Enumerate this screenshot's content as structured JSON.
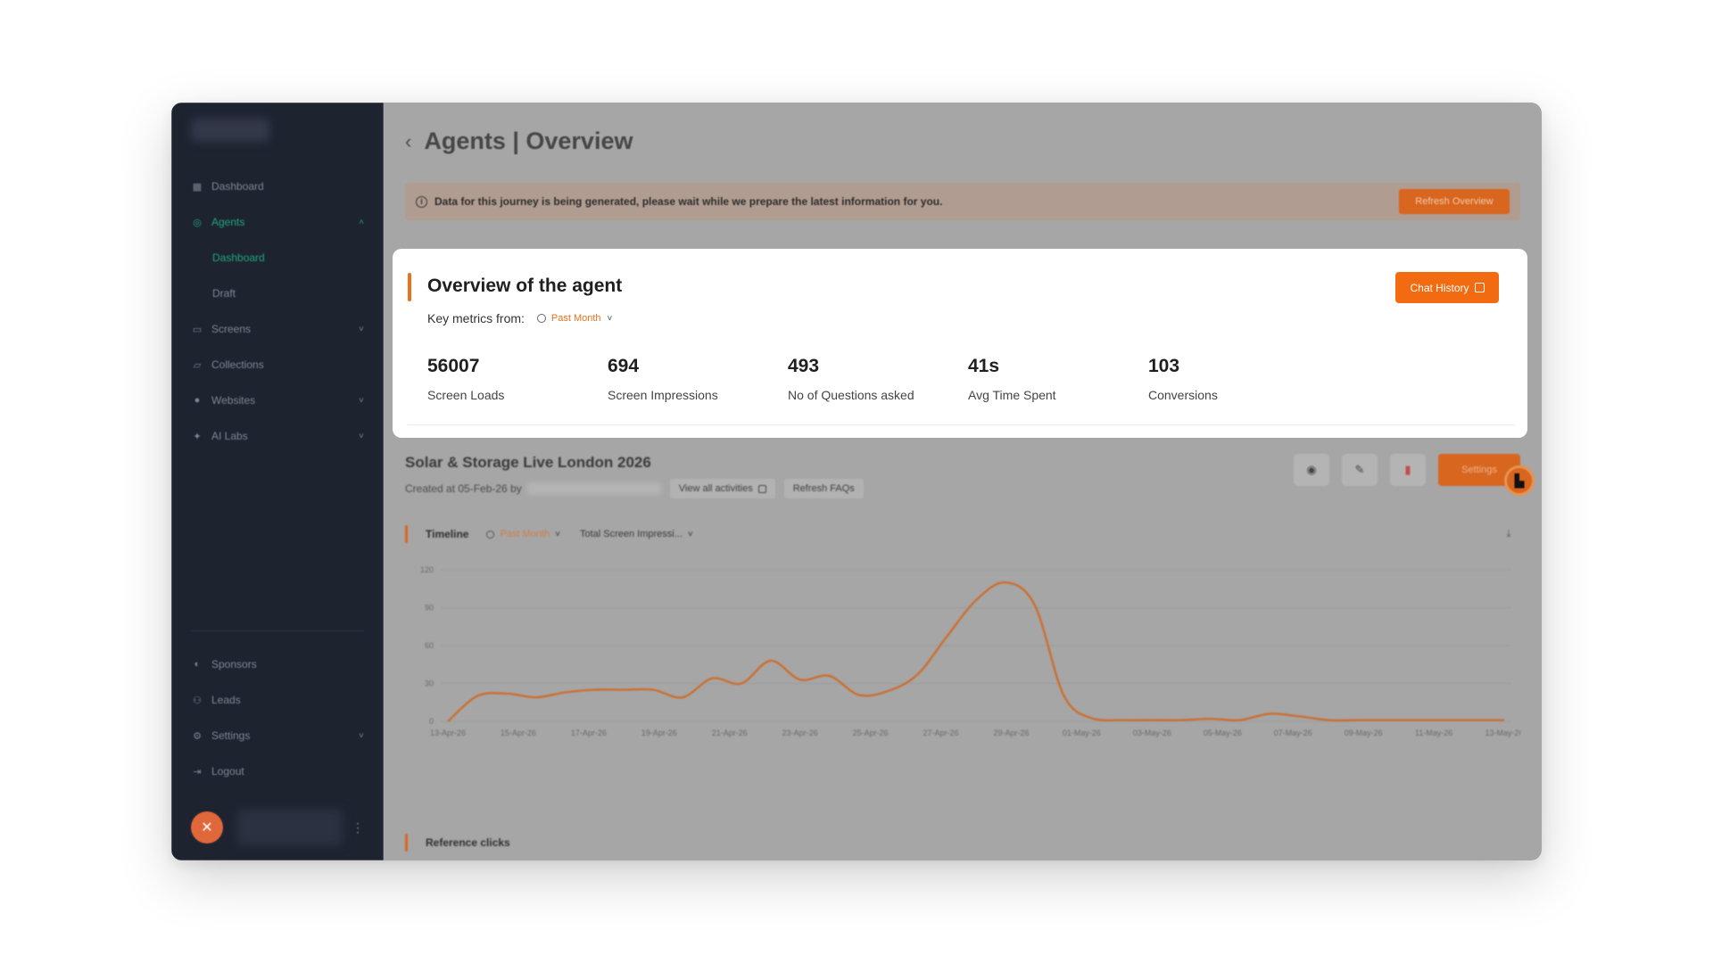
{
  "sidebar": {
    "items": [
      {
        "label": "Dashboard",
        "icon": "grid-icon"
      },
      {
        "label": "Agents",
        "icon": "agent-icon",
        "active": true
      },
      {
        "label": "Screens",
        "icon": "monitor-icon"
      },
      {
        "label": "Collections",
        "icon": "folder-icon"
      },
      {
        "label": "Websites",
        "icon": "globe-icon"
      },
      {
        "label": "AI Labs",
        "icon": "sparkle-icon"
      }
    ],
    "agents_sub": [
      "Dashboard",
      "Draft"
    ],
    "bottom_items": [
      {
        "label": "Sponsors",
        "icon": "sponsor-icon"
      },
      {
        "label": "Leads",
        "icon": "users-icon"
      },
      {
        "label": "Settings",
        "icon": "gear-icon"
      },
      {
        "label": "Logout",
        "icon": "logout-icon"
      }
    ]
  },
  "header": {
    "title": "Agents | Overview",
    "back_glyph": "‹"
  },
  "notice": {
    "text": "Data for this journey is being generated, please wait while we prepare the latest information for you.",
    "button": "Refresh Overview"
  },
  "overview": {
    "title": "Overview of the agent",
    "key_metrics_label": "Key metrics from:",
    "range": "Past Month",
    "chat_button": "Chat History",
    "metrics": [
      {
        "value": "56007",
        "label": "Screen Loads"
      },
      {
        "value": "694",
        "label": "Screen Impressions"
      },
      {
        "value": "493",
        "label": "No of Questions asked"
      },
      {
        "value": "41s",
        "label": "Avg Time Spent"
      },
      {
        "value": "103",
        "label": "Conversions"
      }
    ]
  },
  "journey": {
    "title": "Solar & Storage Live London 2026",
    "created": "Created at 05-Feb-26 by",
    "view_activities": "View all activities",
    "refresh_faqs": "Refresh FAQs",
    "settings_button": "Settings"
  },
  "timeline": {
    "title": "Timeline",
    "range": "Past Month",
    "metric_select": "Total Screen Impressi..."
  },
  "reference_clicks": {
    "title": "Reference clicks"
  },
  "colors": {
    "accent": "#f26b11",
    "sidebar_active": "#1fa57a",
    "sidebar_bg": "#1e2330"
  },
  "chart_data": {
    "type": "line",
    "ylim": [
      0,
      120
    ],
    "yticks": [
      "120",
      "90",
      "60",
      "30",
      "0"
    ],
    "xlabels": [
      "13-Apr-26",
      "15-Apr-26",
      "17-Apr-26",
      "19-Apr-26",
      "21-Apr-26",
      "23-Apr-26",
      "25-Apr-26",
      "27-Apr-26",
      "29-Apr-26",
      "01-May-26",
      "03-May-26",
      "05-May-26",
      "07-May-26",
      "09-May-26",
      "11-May-26",
      "13-May-26"
    ],
    "series": [
      {
        "values": [
          0,
          20,
          22,
          19,
          23,
          25,
          25,
          25,
          19,
          34,
          30,
          48,
          33,
          36,
          21,
          24,
          37,
          67,
          96,
          110,
          92,
          20,
          2,
          1,
          1,
          1,
          2,
          1,
          6,
          4,
          1,
          1,
          1,
          1,
          1,
          1,
          1
        ]
      }
    ]
  }
}
